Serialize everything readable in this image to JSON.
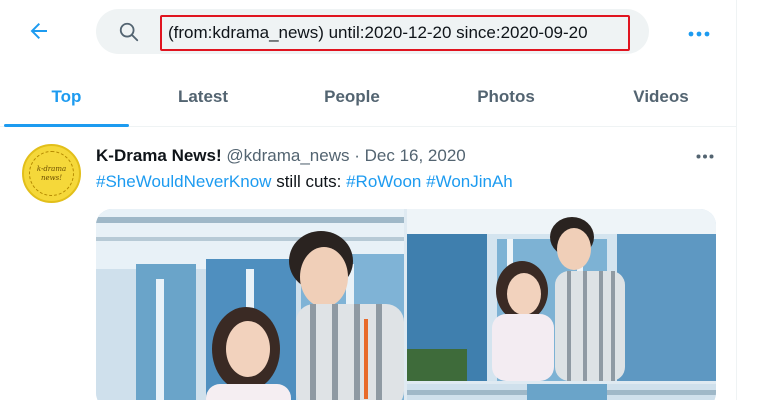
{
  "header": {
    "back_icon": "arrow-left-icon",
    "search_icon": "search-icon",
    "search_value": "(from:kdrama_news) until:2020-12-20 since:2020-09-20",
    "more_icon": "more-horizontal-icon"
  },
  "tabs": [
    {
      "label": "Top",
      "active": true
    },
    {
      "label": "Latest",
      "active": false
    },
    {
      "label": "People",
      "active": false
    },
    {
      "label": "Photos",
      "active": false
    },
    {
      "label": "Videos",
      "active": false
    }
  ],
  "tweet": {
    "avatar_text": "k-drama news!",
    "display_name": "K-Drama News!",
    "handle": "@kdrama_news",
    "separator": "·",
    "date": "Dec 16, 2020",
    "text_parts": [
      {
        "text": "#SheWouldNeverKnow",
        "hashtag": true
      },
      {
        "text": " still cuts: ",
        "hashtag": false
      },
      {
        "text": "#RoWoon",
        "hashtag": true
      },
      {
        "text": " ",
        "hashtag": false
      },
      {
        "text": "#WonJinAh",
        "hashtag": true
      }
    ],
    "media_count": 3
  },
  "colors": {
    "accent": "#1d9bf0",
    "text": "#0f1419",
    "muted": "#536471",
    "highlight_box": "#e0141f",
    "search_bg": "#eff3f4"
  }
}
